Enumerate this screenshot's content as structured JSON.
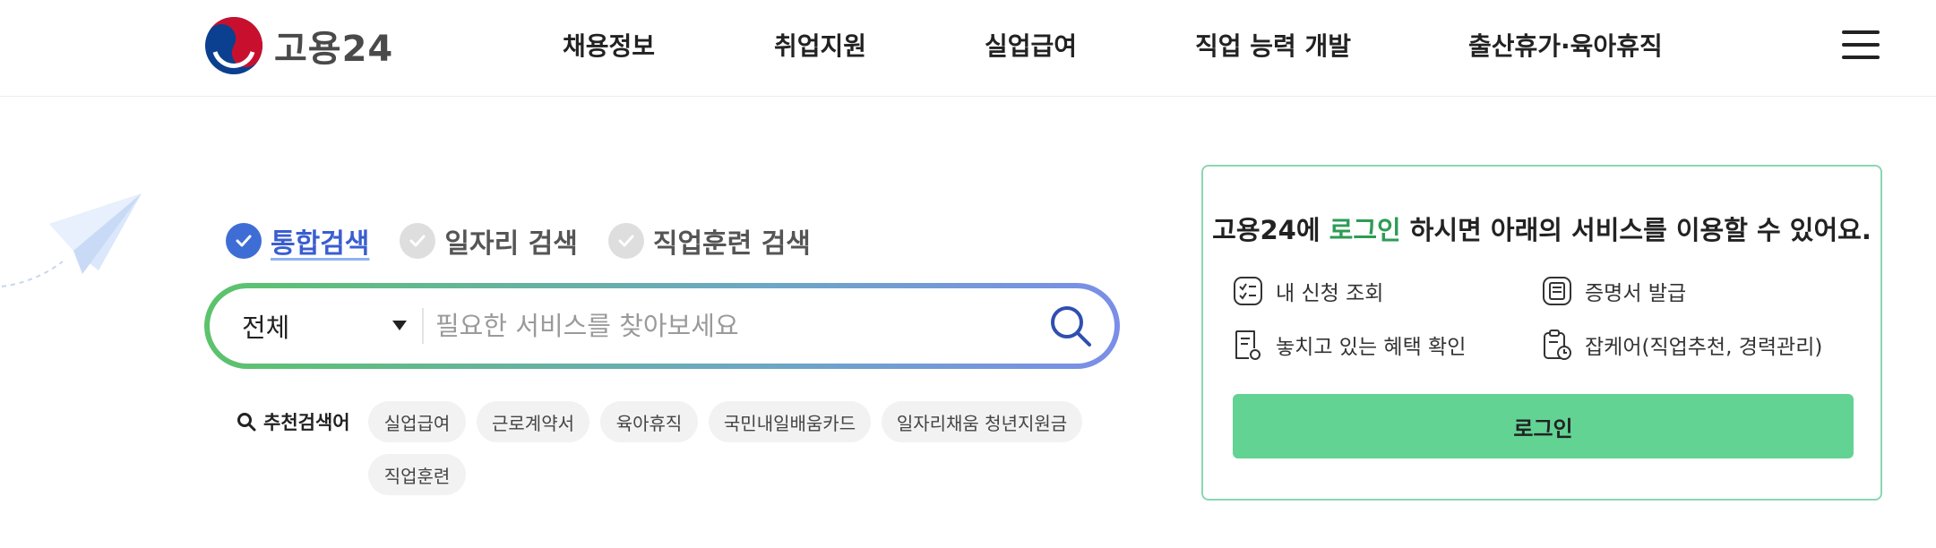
{
  "header": {
    "logo_text": "고용24",
    "nav": [
      {
        "label": "채용정보"
      },
      {
        "label": "취업지원"
      },
      {
        "label": "실업급여"
      },
      {
        "label": "직업 능력 개발"
      },
      {
        "label": "출산휴가·육아휴직"
      }
    ],
    "menu_icon": "hamburger-menu-icon"
  },
  "search": {
    "tabs": [
      {
        "label": "통합검색",
        "active": true
      },
      {
        "label": "일자리 검색",
        "active": false
      },
      {
        "label": "직업훈련 검색",
        "active": false
      }
    ],
    "category": "전체",
    "placeholder": "필요한 서비스를 찾아보세요",
    "button_icon": "search-icon",
    "gradient": [
      "#5cc36b",
      "#7a8ee8"
    ]
  },
  "recommended": {
    "label": "추천검색어",
    "keywords": [
      "실업급여",
      "근로계약서",
      "육아휴직",
      "국민내일배움카드",
      "일자리채움 청년지원금",
      "직업훈련"
    ]
  },
  "login_panel": {
    "message_prefix": "고용24에 ",
    "message_highlight": "로그인",
    "message_suffix": " 하시면 아래의 서비스를 이용할 수 있어요.",
    "services": [
      {
        "label": "내 신청 조회",
        "icon": "checklist-icon"
      },
      {
        "label": "증명서 발급",
        "icon": "certificate-icon"
      },
      {
        "label": "놓치고 있는 혜택 확인",
        "icon": "document-benefit-icon"
      },
      {
        "label": "잡케어(직업추천, 경력관리)",
        "icon": "clipboard-clock-icon"
      }
    ],
    "login_button": "로그인",
    "accent": "#62d393"
  }
}
